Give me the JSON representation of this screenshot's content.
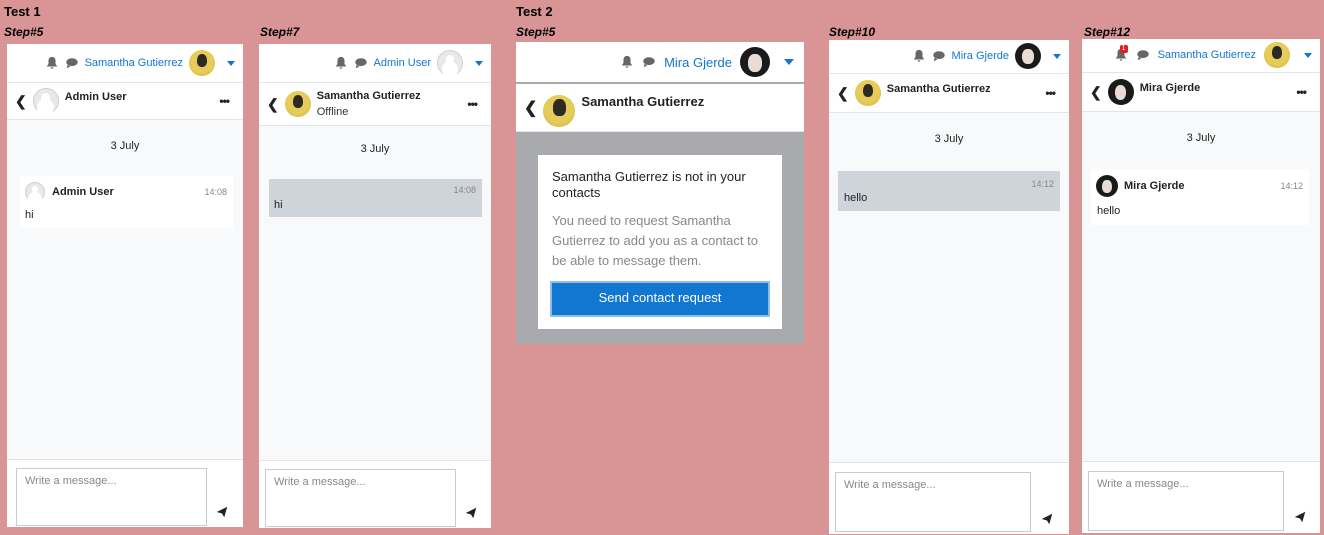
{
  "labels": {
    "test1": "Test 1",
    "test2": "Test 2",
    "step5a": "Step#5",
    "step7": "Step#7",
    "step5b": "Step#5",
    "step10": "Step#10",
    "step12": "Step#12"
  },
  "panels": {
    "p1": {
      "user": "Samantha Gutierrez",
      "contact": "Admin User",
      "date": "3 July",
      "sender": "Admin User",
      "time": "14:08",
      "message": "hi",
      "placeholder": "Write a message..."
    },
    "p2": {
      "user": "Admin User",
      "contact": "Samantha Gutierrez",
      "status": "Offline",
      "date": "3 July",
      "time": "14:08",
      "message": "hi",
      "placeholder": "Write a message..."
    },
    "p3": {
      "user": "Mira Gjerde",
      "contact": "Samantha Gutierrez",
      "notice_title": "Samantha Gutierrez is not in your contacts",
      "notice_text": "You need to request Samantha Gutierrez to add you as a contact to be able to message them.",
      "button": "Send contact request"
    },
    "p4": {
      "user": "Mira Gjerde",
      "contact": "Samantha Gutierrez",
      "date": "3 July",
      "time": "14:12",
      "message": "hello",
      "placeholder": "Write a message..."
    },
    "p5": {
      "user": "Samantha Gutierrez",
      "contact": "Mira Gjerde",
      "badge": "1",
      "date": "3 July",
      "sender": "Mira Gjerde",
      "time": "14:12",
      "message": "hello",
      "placeholder": "Write a message..."
    }
  },
  "colors": {
    "background": "#d99595",
    "accent": "#1177d1",
    "outgoing_bubble": "#cfd4da"
  }
}
